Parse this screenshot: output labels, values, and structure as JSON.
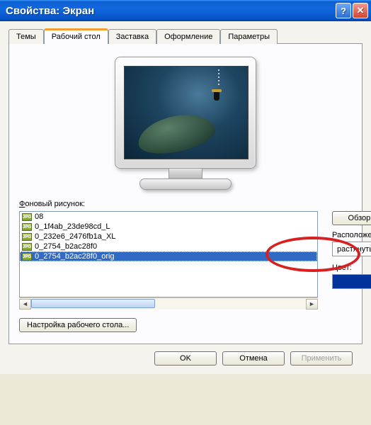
{
  "title": "Свойства: Экран",
  "tabs": {
    "themes": "Темы",
    "desktop": "Рабочий стол",
    "screensaver": "Заставка",
    "appearance": "Оформление",
    "settings": "Параметры"
  },
  "labels": {
    "background": "Фоновый рисунок:",
    "browse": "Обзор...",
    "position": "Расположение:",
    "color": "Цвет:",
    "customize": "Настройка рабочего стола..."
  },
  "position_value": "растянуть",
  "color_value": "#003399",
  "list": [
    "08",
    "0_1f4ab_23de98cd_L",
    "0_232e6_2476fb1a_XL",
    "0_2754_b2ac28f0",
    "0_2754_b2ac28f0_orig"
  ],
  "selected_index": 4,
  "buttons": {
    "ok": "OK",
    "cancel": "Отмена",
    "apply": "Применить"
  }
}
